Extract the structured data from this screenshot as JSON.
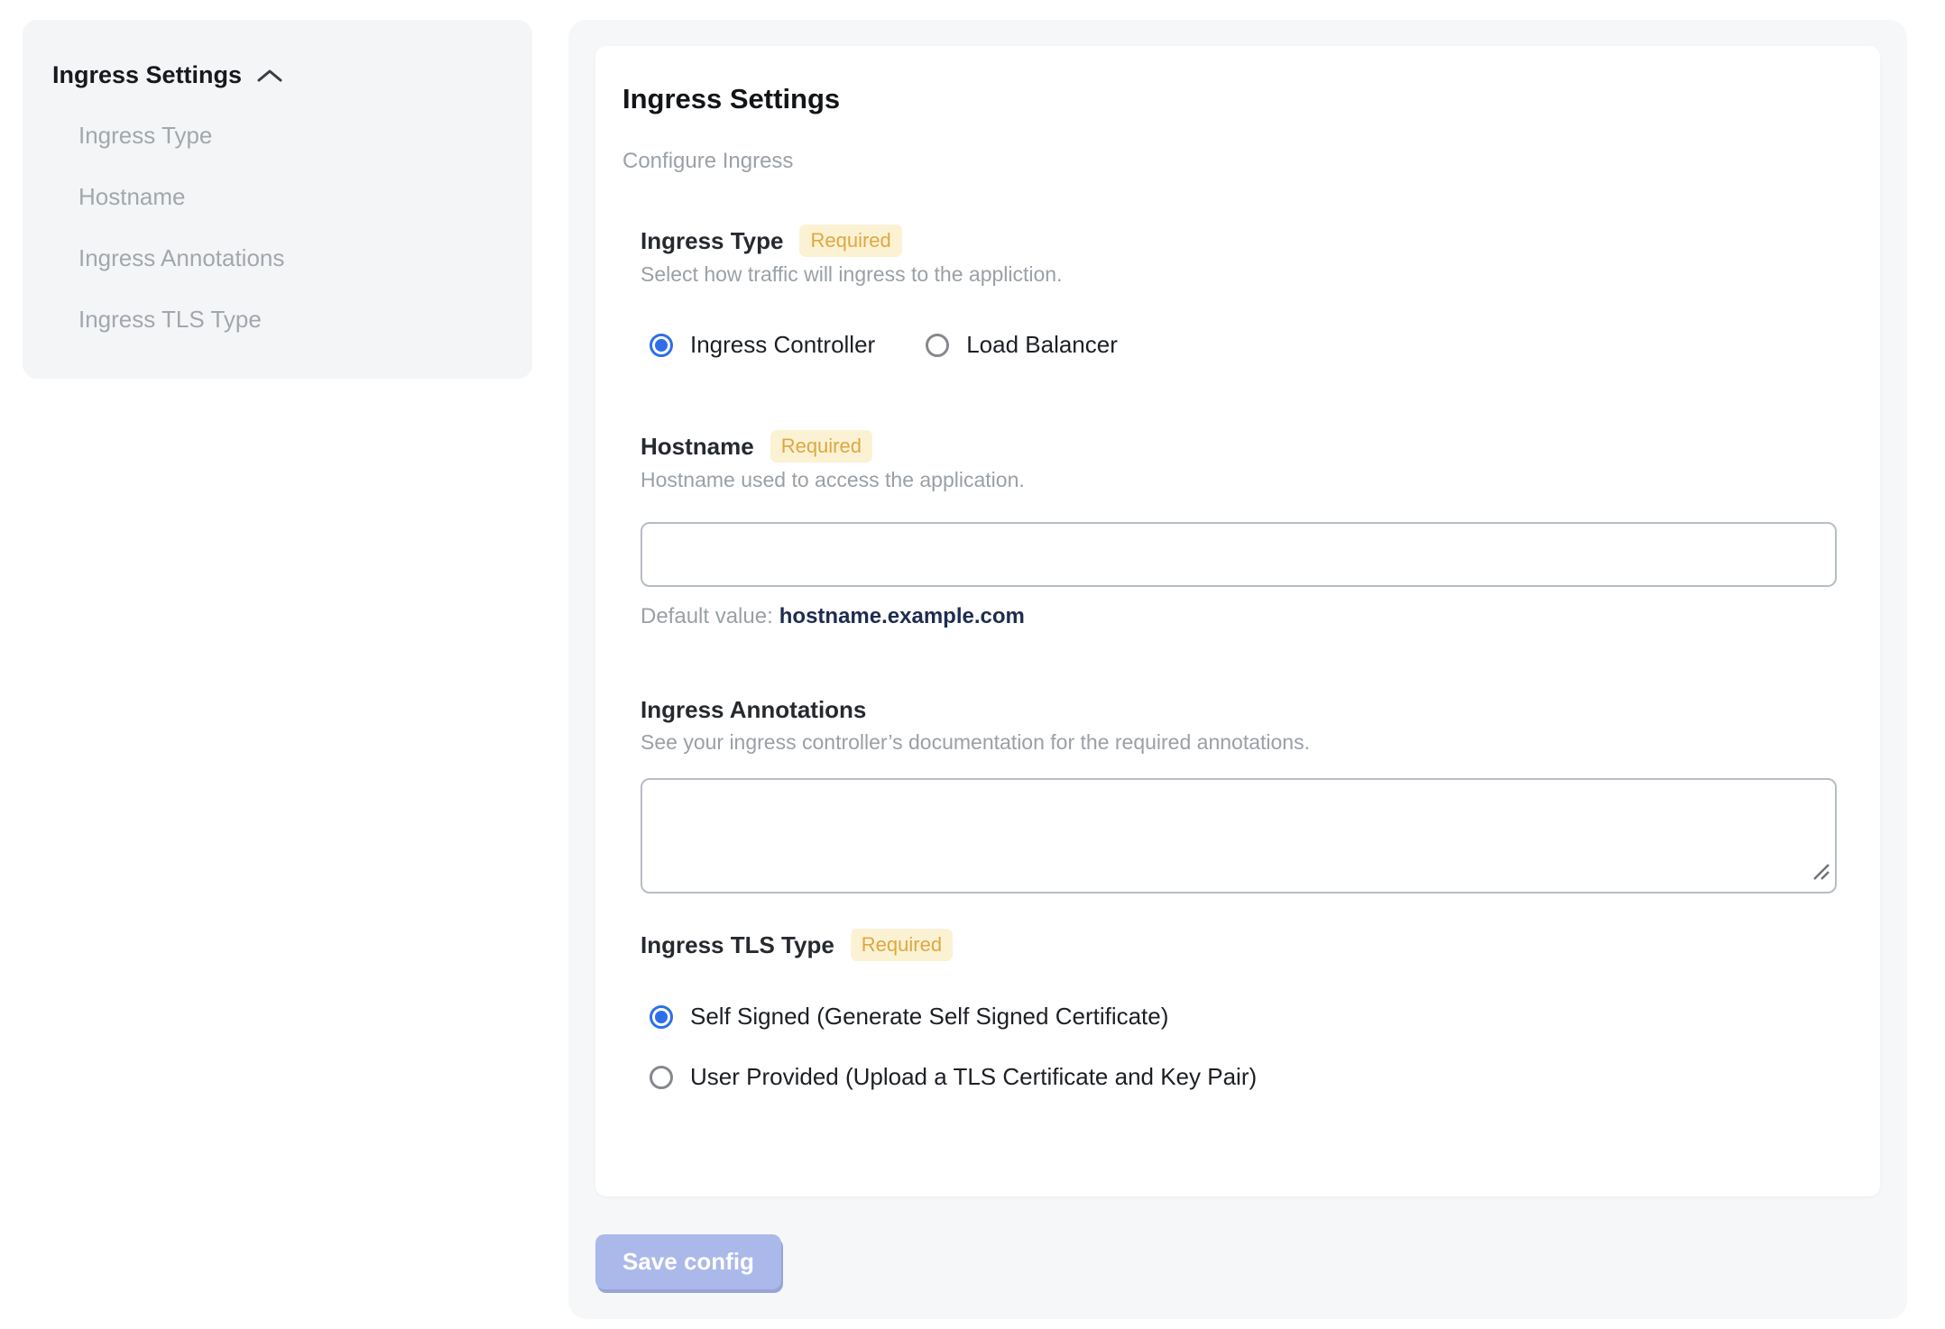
{
  "sidebar": {
    "title": "Ingress Settings",
    "items": [
      {
        "label": "Ingress Type"
      },
      {
        "label": "Hostname"
      },
      {
        "label": "Ingress Annotations"
      },
      {
        "label": "Ingress TLS Type"
      }
    ]
  },
  "panel": {
    "title": "Ingress Settings",
    "subtitle": "Configure Ingress",
    "save_button_label": "Save config",
    "sections": {
      "ingress_type": {
        "label": "Ingress Type",
        "required_label": "Required",
        "description": "Select how traffic will ingress to the appliction.",
        "options": [
          {
            "label": "Ingress Controller",
            "selected": true
          },
          {
            "label": "Load Balancer",
            "selected": false
          }
        ]
      },
      "hostname": {
        "label": "Hostname",
        "required_label": "Required",
        "description": "Hostname used to access the application.",
        "value": "",
        "default_value_label": "Default value:",
        "default_value": "hostname.example.com"
      },
      "ingress_annotations": {
        "label": "Ingress Annotations",
        "description": "See your ingress controller’s documentation for the required annotations.",
        "value": ""
      },
      "ingress_tls_type": {
        "label": "Ingress TLS Type",
        "required_label": "Required",
        "options": [
          {
            "label": "Self Signed (Generate Self Signed Certificate)",
            "selected": true
          },
          {
            "label": "User Provided (Upload a TLS Certificate and Key Pair)",
            "selected": false
          }
        ]
      }
    }
  },
  "colors": {
    "accent_blue": "#2e6ee8",
    "required_badge_bg": "#fbf2d4",
    "required_badge_text": "#e0a73f",
    "save_button_bg": "#abb9ea",
    "default_value_text": "#1d2c4f",
    "panel_bg": "#f5f7f9",
    "sidebar_bg": "#f4f5f7"
  }
}
